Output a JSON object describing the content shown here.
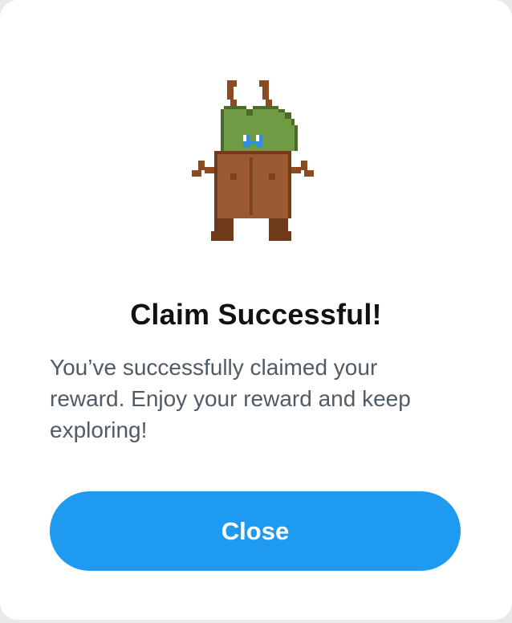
{
  "modal": {
    "mascot_icon": "pixel-bug-mascot-icon",
    "title": "Claim Successful!",
    "message": "You’ve successfully claimed your reward. Enjoy your reward and keep exploring!",
    "close_label": "Close"
  },
  "colors": {
    "accent": "#1e9bf0",
    "title": "#111111",
    "body_text": "#4f5b66",
    "background": "#ffffff"
  }
}
